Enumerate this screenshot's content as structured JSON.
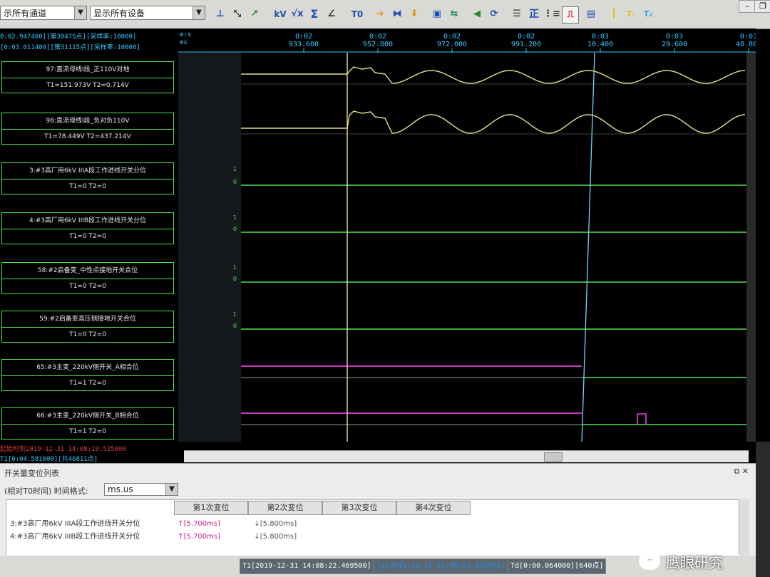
{
  "toolbar": {
    "channel_filter": "示所有通道",
    "device_filter": "显示所有设备",
    "icons": [
      "cursor-icon",
      "zoom-icon",
      "trend-icon",
      "kv-icon",
      "sqrt-icon",
      "sigma-icon",
      "angle-icon",
      "t0-icon",
      "arrow-right-icon",
      "hourglass-icon",
      "arrow-down-icon",
      "image-icon",
      "swap-icon",
      "left-icon",
      "refresh-icon",
      "list-icon",
      "positive-icon",
      "align-icon",
      "pulse-icon",
      "book-icon",
      "bar-icon",
      "t1-icon",
      "t2-icon"
    ],
    "kv_label": "kV",
    "sigma_label": "Σ",
    "t0_label": "T0",
    "zheng_label": "正"
  },
  "header_left": {
    "line1": "0:02.947400][第30475点][采样率:10000]",
    "line2": "[0:03.011400][第31115点][采样率:10000]"
  },
  "time_axis": {
    "unit_top": "m:s",
    "unit_bottom": "ms",
    "ticks": [
      {
        "top": "0:02",
        "bottom": "933.600"
      },
      {
        "top": "0:02",
        "bottom": "952.800"
      },
      {
        "top": "0:02",
        "bottom": "972.000"
      },
      {
        "top": "0:02",
        "bottom": "991.200"
      },
      {
        "top": "0:03",
        "bottom": "10.400"
      },
      {
        "top": "0:03",
        "bottom": "29.600"
      },
      {
        "top": "0:03",
        "bottom": "48.800"
      }
    ]
  },
  "channels": [
    {
      "name": "97:直流母线I段_正110V对地",
      "vals": "T1=151.973V T2=0.714V"
    },
    {
      "name": "98:直流母线I段_负对负110V",
      "vals": "T1=78.449V T2=437.214V"
    },
    {
      "name": "3:#3高厂用6kV IIIA段工作进线开关分位",
      "vals": "T1=0 T2=0"
    },
    {
      "name": "4:#3高厂用6kV IIIB段工作进线开关分位",
      "vals": "T1=0 T2=0"
    },
    {
      "name": "58:#2启备变_中性点接地开关合位",
      "vals": "T1=0 T2=0"
    },
    {
      "name": "59:#2启备变高压侧接地开关合位",
      "vals": "T1=0 T2=0"
    },
    {
      "name": "65:#3主变_220kV侧开关_A相合位",
      "vals": "T1=1 T2=0"
    },
    {
      "name": "66:#3主变_220kV侧开关_B相合位",
      "vals": "T1=1 T2=0"
    }
  ],
  "cursors": {
    "t1_label": "T1",
    "t2_label": "T2"
  },
  "digital_levels": {
    "one": "1",
    "zero": "0"
  },
  "footer_left": {
    "line1": "起始时刻2019-12-31 14:08:19.535800",
    "line2": "T1[0:04.581000][共46811点]"
  },
  "lower_panel": {
    "title": "开关量变位列表",
    "time_mode_label": "(相对T0时间) 时间格式:",
    "time_format": "ms.us",
    "columns": [
      "第1次变位",
      "第2次变位",
      "第3次变位",
      "第4次变位"
    ],
    "rows": [
      {
        "name": "3:#3高厂用6kV IIIA段工作进线开关分位",
        "c1": "↑[5.700ms]",
        "c2": "↓[5.800ms]"
      },
      {
        "name": "4:#3高厂用6kV IIIB段工作进线开关分位",
        "c1": "↑[5.700ms]",
        "c2": "↓[5.800ms]"
      }
    ]
  },
  "status": {
    "t1": "T1[2019-12-31 14:08:22.469500]",
    "t2": "T2[2019-12-31 14:08:22.533500]",
    "td": "Td[0:00.064000][640点]"
  },
  "watermark": "鹰眼研究",
  "colors": {
    "analog_trace": "#e4e48a",
    "digital_line": "#4ee24e",
    "magenta_line": "#e040e0",
    "cursor_t1": "#ffe6b0",
    "cursor_t2": "#6fd8ff",
    "axis_text": "#35c7ff"
  }
}
